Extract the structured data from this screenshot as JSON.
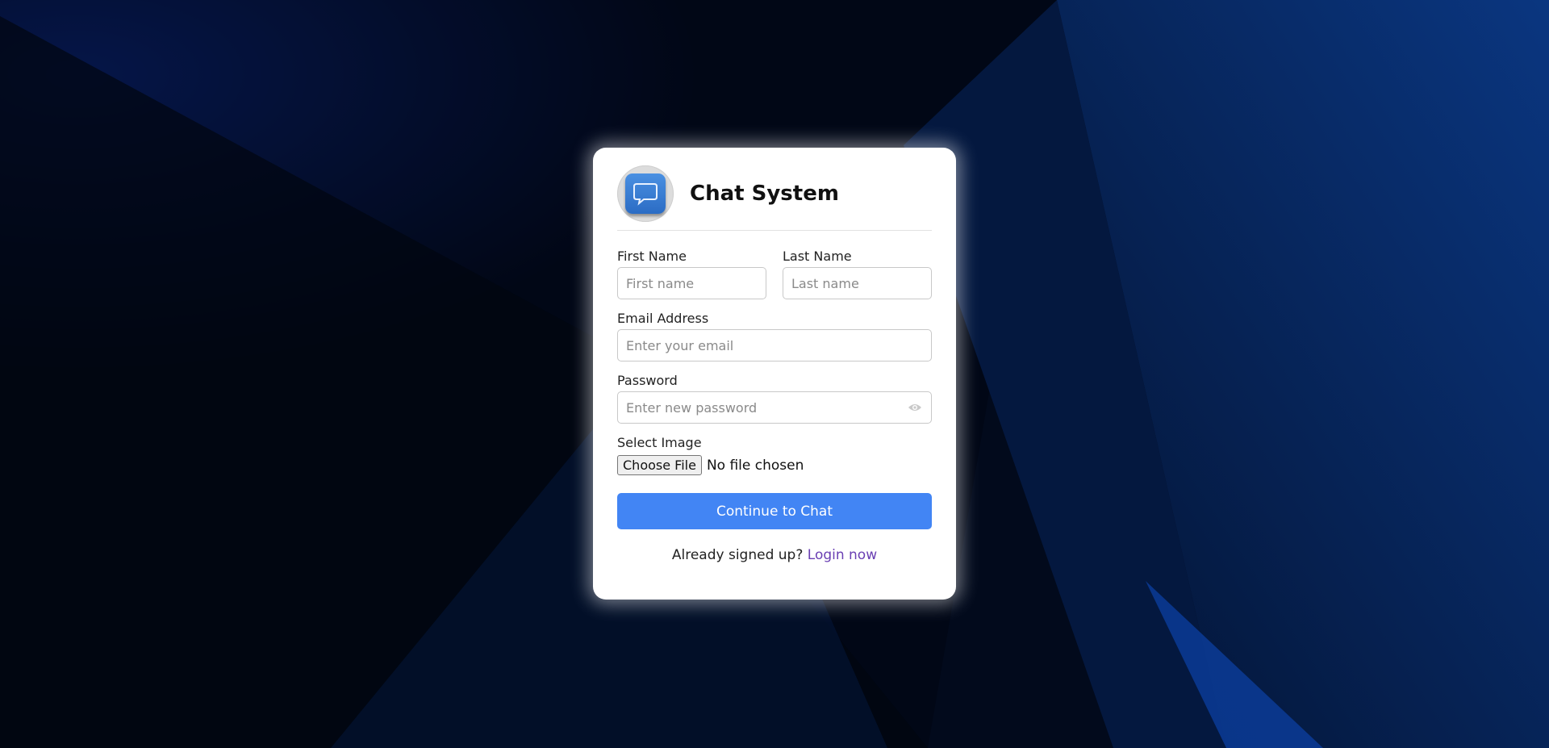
{
  "app": {
    "title": "Chat System",
    "logo_icon": "chat-bubble-icon"
  },
  "form": {
    "first_name": {
      "label": "First Name",
      "placeholder": "First name",
      "value": ""
    },
    "last_name": {
      "label": "Last Name",
      "placeholder": "Last name",
      "value": ""
    },
    "email": {
      "label": "Email Address",
      "placeholder": "Enter your email",
      "value": ""
    },
    "password": {
      "label": "Password",
      "placeholder": "Enter new password",
      "value": "",
      "toggle_icon": "eye-icon"
    },
    "image": {
      "label": "Select Image",
      "button_label": "Choose File",
      "status": "No file chosen"
    },
    "submit_label": "Continue to Chat"
  },
  "footer": {
    "prompt": "Already signed up?",
    "link_label": "Login now"
  },
  "colors": {
    "accent": "#4285f4",
    "link": "#6a3fb3",
    "background": "#020a1c"
  }
}
